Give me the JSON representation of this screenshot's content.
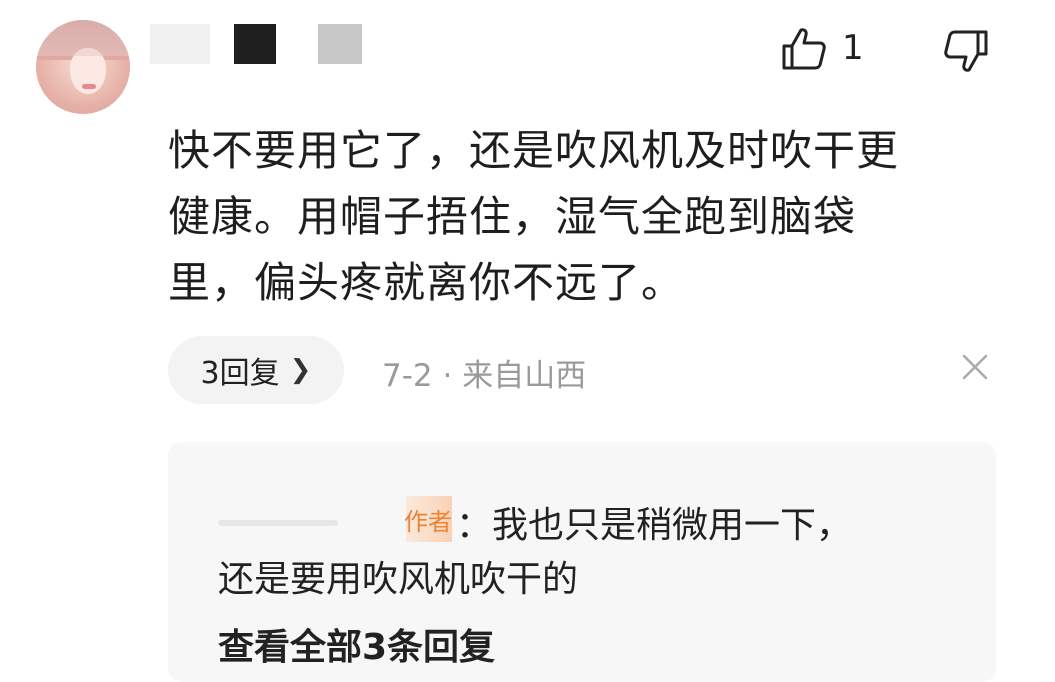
{
  "comment": {
    "like_count": "1",
    "text_lines": [
      "快不要用它了，还是吹风机及时吹干更",
      "健康。用帽子捂住，湿气全跑到脑袋",
      "里，偏头疼就离你不远了。"
    ],
    "replies_label": "3回复",
    "meta": "7-2 · 来自山西"
  },
  "reply": {
    "author_tag": "作者",
    "line1": "：我也只是稍微用一下，",
    "line2": "还是要用吹风机吹干的",
    "view_all": "查看全部3条回复"
  },
  "icons": {
    "like": "thumbs-up-icon",
    "dislike": "thumbs-down-icon",
    "close": "close-icon",
    "chevron": "chevron-right-icon"
  },
  "colors": {
    "author_tag": "#e9853a",
    "meta_text": "#9a9a9a",
    "pill_bg": "#f3f3f3",
    "reply_bg": "#f7f7f7"
  }
}
